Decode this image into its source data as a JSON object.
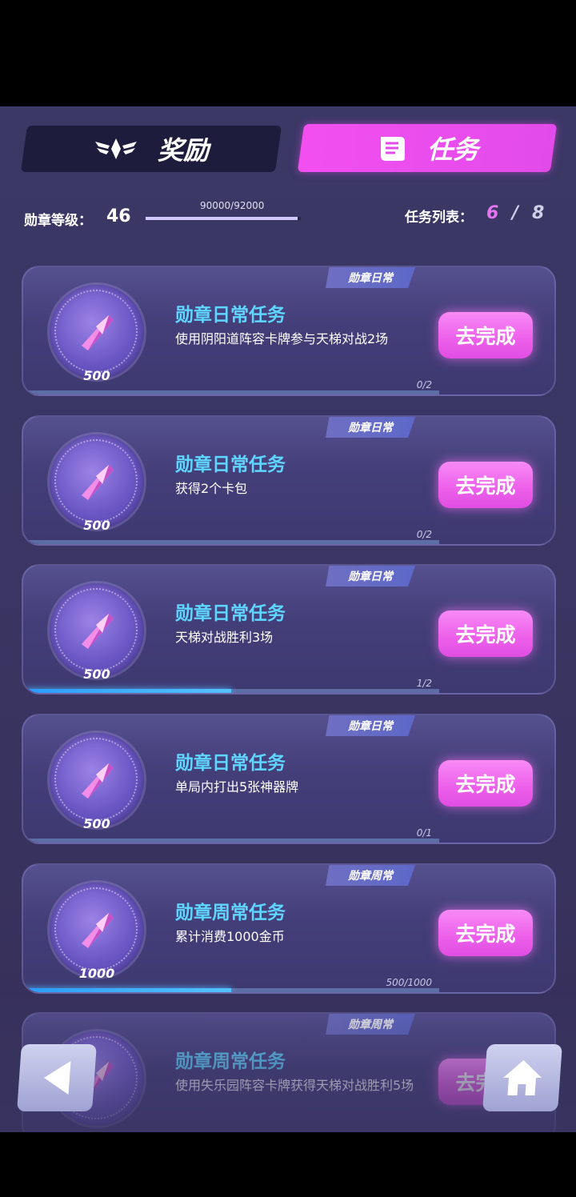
{
  "tabs": {
    "reward": "奖励",
    "task": "任务"
  },
  "header": {
    "level_label": "勋章等级：",
    "level_value": "46",
    "exp_text": "90000/92000",
    "exp_ratio": 0.978,
    "task_list_label": "任务列表：",
    "task_done": "6",
    "task_slash": "/",
    "task_total": "8"
  },
  "tasks": [
    {
      "tag": "勋章日常",
      "title": "勋章日常任务",
      "desc": "使用阴阳道阵容卡牌参与天梯对战2场",
      "points": "500",
      "button": "去完成",
      "progress_text": "0/2",
      "progress": 0
    },
    {
      "tag": "勋章日常",
      "title": "勋章日常任务",
      "desc": "获得2个卡包",
      "points": "500",
      "button": "去完成",
      "progress_text": "0/2",
      "progress": 0
    },
    {
      "tag": "勋章日常",
      "title": "勋章日常任务",
      "desc": "天梯对战胜利3场",
      "points": "500",
      "button": "去完成",
      "progress_text": "1/2",
      "progress": 0.5
    },
    {
      "tag": "勋章日常",
      "title": "勋章日常任务",
      "desc": "单局内打出5张神器牌",
      "points": "500",
      "button": "去完成",
      "progress_text": "0/1",
      "progress": 0
    },
    {
      "tag": "勋章周常",
      "title": "勋章周常任务",
      "desc": "累计消费1000金币",
      "points": "1000",
      "button": "去完成",
      "progress_text": "500/1000",
      "progress": 0.5
    },
    {
      "tag": "勋章周常",
      "title": "勋章周常任务",
      "desc": "使用失乐园阵容卡牌获得天梯对战胜利5场",
      "points": "",
      "button": "去完成",
      "progress_text": "",
      "progress": 0
    }
  ],
  "nav": {
    "back_icon": "back-arrow-icon",
    "home_icon": "home-icon"
  }
}
